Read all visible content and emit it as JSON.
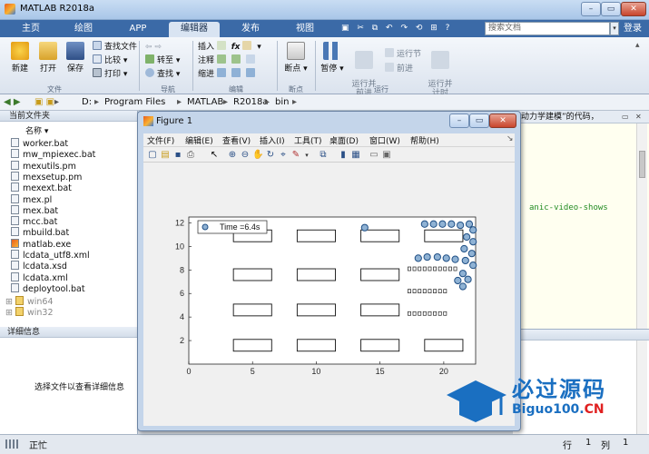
{
  "app": {
    "title": "MATLAB R2018a"
  },
  "tabs": [
    {
      "label": "主页"
    },
    {
      "label": "绘图"
    },
    {
      "label": "APP"
    },
    {
      "label": "编辑器"
    },
    {
      "label": "发布"
    },
    {
      "label": "视图"
    }
  ],
  "search": {
    "placeholder": "搜索文档"
  },
  "login": "登录",
  "ribbon": {
    "file_group": {
      "new": "新建",
      "open": "打开",
      "save": "保存",
      "find_files": "查找文件",
      "compare": "比较",
      "print": "打印",
      "label": "文件"
    },
    "nav_group": {
      "goto": "转至",
      "find": "查找",
      "label": "导航"
    },
    "edit_group": {
      "insert": "插入",
      "comment": "注释",
      "indent": "缩进",
      "label": "编辑",
      "fx": "fx"
    },
    "breakpoint_group": {
      "breakpoints": "断点",
      "label": "断点"
    },
    "run_group": {
      "pause": "暂停",
      "run_advance": "运行并\n前进",
      "run_section": "运行节",
      "advance": "前进",
      "run_time": "运行并\n计时",
      "label": "运行"
    }
  },
  "address": [
    "D:",
    "Program Files",
    "MATLAB",
    "R2018a",
    "bin"
  ],
  "left_panel": {
    "header": "当前文件夹",
    "column": "名称",
    "files": [
      "worker.bat",
      "mw_mpiexec.bat",
      "mexutils.pm",
      "mexsetup.pm",
      "mexext.bat",
      "mex.pl",
      "mex.bat",
      "mcc.bat",
      "mbuild.bat",
      "matlab.exe",
      "lcdata_utf8.xml",
      "lcdata.xsd",
      "lcdata.xml",
      "deploytool.bat"
    ],
    "folders": [
      "win64",
      "win32"
    ],
    "details_header": "详细信息",
    "details_text": "选择文件以查看详细信息"
  },
  "editor": {
    "tab_text": "动力学建模”的代码，",
    "code_line": "anic-video-shows"
  },
  "status": {
    "text": "正忙",
    "row_label": "行",
    "row": "1",
    "col_label": "列",
    "col": "1"
  },
  "figure": {
    "title": "Figure 1",
    "menu": [
      "文件(F)",
      "编辑(E)",
      "查看(V)",
      "插入(I)",
      "工具(T)",
      "桌面(D)",
      "窗口(W)",
      "帮助(H)"
    ]
  },
  "chart_data": {
    "type": "scatter",
    "title": "",
    "xlabel": "",
    "ylabel": "",
    "xlim": [
      0,
      22.5
    ],
    "ylim": [
      0,
      12.5
    ],
    "xticks": [
      0,
      5,
      10,
      15,
      20
    ],
    "yticks": [
      2,
      4,
      6,
      8,
      10,
      12
    ],
    "legend": {
      "label": "Time =6.4s",
      "position": "top-left"
    },
    "series": [
      {
        "marker": "circle",
        "points": [
          [
            13.8,
            11.6
          ],
          [
            18.5,
            11.9
          ],
          [
            19.2,
            11.9
          ],
          [
            19.9,
            11.9
          ],
          [
            20.6,
            11.9
          ],
          [
            21.3,
            11.8
          ],
          [
            22.0,
            11.9
          ],
          [
            22.3,
            11.4
          ],
          [
            21.8,
            10.8
          ],
          [
            22.3,
            10.4
          ],
          [
            21.6,
            9.8
          ],
          [
            22.2,
            9.4
          ],
          [
            21.7,
            8.8
          ],
          [
            22.3,
            8.4
          ],
          [
            21.5,
            7.7
          ],
          [
            21.1,
            7.1
          ],
          [
            21.9,
            7.2
          ],
          [
            21.5,
            6.6
          ],
          [
            18.0,
            9.0
          ],
          [
            18.7,
            9.1
          ],
          [
            19.5,
            9.1
          ],
          [
            20.2,
            9.0
          ],
          [
            20.9,
            8.9
          ]
        ]
      },
      {
        "marker": "square",
        "points": [
          [
            17.3,
            8.1
          ],
          [
            17.7,
            8.1
          ],
          [
            18.1,
            8.1
          ],
          [
            18.5,
            8.1
          ],
          [
            18.9,
            8.1
          ],
          [
            19.3,
            8.1
          ],
          [
            19.7,
            8.1
          ],
          [
            20.1,
            8.1
          ],
          [
            20.5,
            8.1
          ],
          [
            20.9,
            8.1
          ],
          [
            17.3,
            6.2
          ],
          [
            17.7,
            6.2
          ],
          [
            18.1,
            6.2
          ],
          [
            18.5,
            6.2
          ],
          [
            18.9,
            6.2
          ],
          [
            19.3,
            6.2
          ],
          [
            19.7,
            6.2
          ],
          [
            20.1,
            6.2
          ],
          [
            17.3,
            4.3
          ],
          [
            17.7,
            4.3
          ],
          [
            18.1,
            4.3
          ],
          [
            18.5,
            4.3
          ],
          [
            18.9,
            4.3
          ],
          [
            19.3,
            4.3
          ],
          [
            19.7,
            4.3
          ],
          [
            20.1,
            4.3
          ]
        ]
      }
    ],
    "rectangles": [
      [
        3.5,
        10.4,
        6.5,
        11.4
      ],
      [
        8.5,
        10.4,
        11.5,
        11.4
      ],
      [
        13.5,
        10.4,
        16.5,
        11.4
      ],
      [
        18.5,
        10.4,
        21.5,
        11.4
      ],
      [
        3.5,
        7.1,
        6.5,
        8.1
      ],
      [
        8.5,
        7.1,
        11.5,
        8.1
      ],
      [
        13.5,
        7.1,
        16.5,
        8.1
      ],
      [
        3.5,
        4.1,
        6.5,
        5.1
      ],
      [
        8.5,
        4.1,
        11.5,
        5.1
      ],
      [
        13.5,
        4.1,
        16.5,
        5.1
      ],
      [
        3.5,
        1.1,
        6.5,
        2.1
      ],
      [
        8.5,
        1.1,
        11.5,
        2.1
      ],
      [
        13.5,
        1.1,
        16.5,
        2.1
      ],
      [
        18.5,
        1.1,
        21.5,
        2.1
      ]
    ]
  },
  "watermark": {
    "cn": "必过源码",
    "en_main": "Biguo100.",
    "en_cn": "CN"
  },
  "colors": {
    "accent": "#3b6aa7",
    "marker_face": "#8fb2d4",
    "marker_edge": "#1f4f85"
  }
}
